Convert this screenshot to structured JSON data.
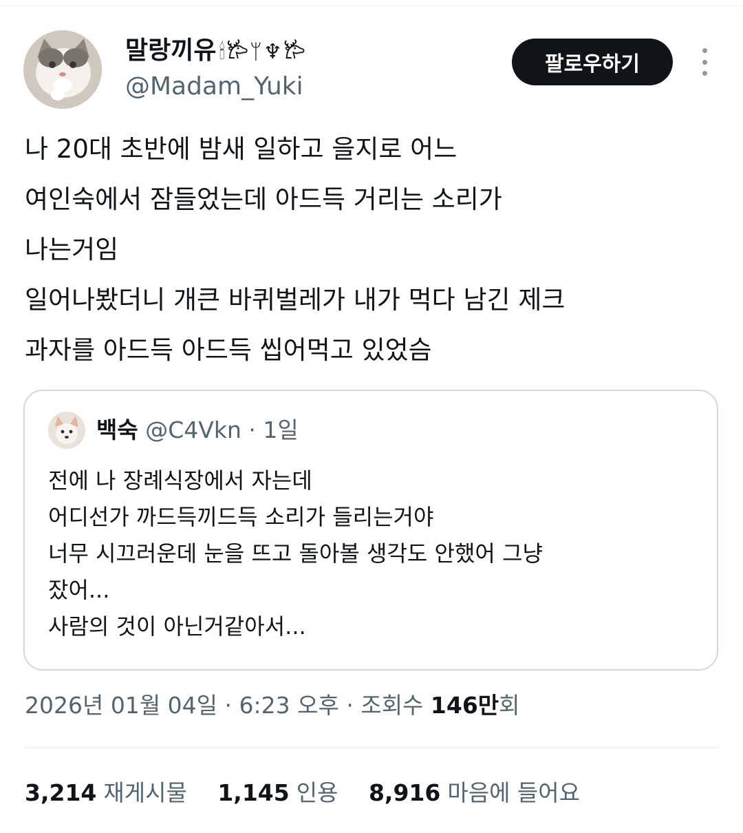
{
  "author": {
    "display_name": "말랑끼유",
    "display_name_deco": "🕯𐂂ᛘ♆𐂂",
    "handle": "@Madam_Yuki"
  },
  "actions": {
    "follow_label": "팔로우하기"
  },
  "tweet": {
    "lines": [
      "나 20대 초반에 밤새 일하고 을지로 어느",
      "여인숙에서 잠들었는데 아드득 거리는 소리가",
      "나는거임",
      "일어나봤더니 개큰 바퀴벌레가 내가 먹다 남긴 제크",
      "과자를 아드득 아드득 씹어먹고 있었슴"
    ]
  },
  "quote": {
    "name": "백숙",
    "handle": "@C4Vkn",
    "separator": " · ",
    "time": "1일",
    "lines": [
      "전에 나 장례식장에서 자는데",
      "어디선가 까드득끼드득 소리가 들리는거야",
      "너무 시끄러운데 눈을 뜨고 돌아볼 생각도 안했어 그냥",
      "잤어...",
      "사람의 것이 아닌거같아서..."
    ]
  },
  "meta": {
    "date": "2026년 01월 04일",
    "sep1": " · ",
    "time": "6:23 오후",
    "sep2": " · ",
    "views_label": "조회수 ",
    "views_number": "146만",
    "views_suffix": "회"
  },
  "stats": {
    "retweets": {
      "count": "3,214",
      "label": "재게시물"
    },
    "quotes": {
      "count": "1,145",
      "label": "인용"
    },
    "likes": {
      "count": "8,916",
      "label": "마음에 들어요"
    }
  },
  "icons": {
    "more": "more-vertical-icon"
  },
  "colors": {
    "text": "#0f1419",
    "secondary": "#536471",
    "button_bg": "#0f1419",
    "border": "#cfd9de"
  }
}
